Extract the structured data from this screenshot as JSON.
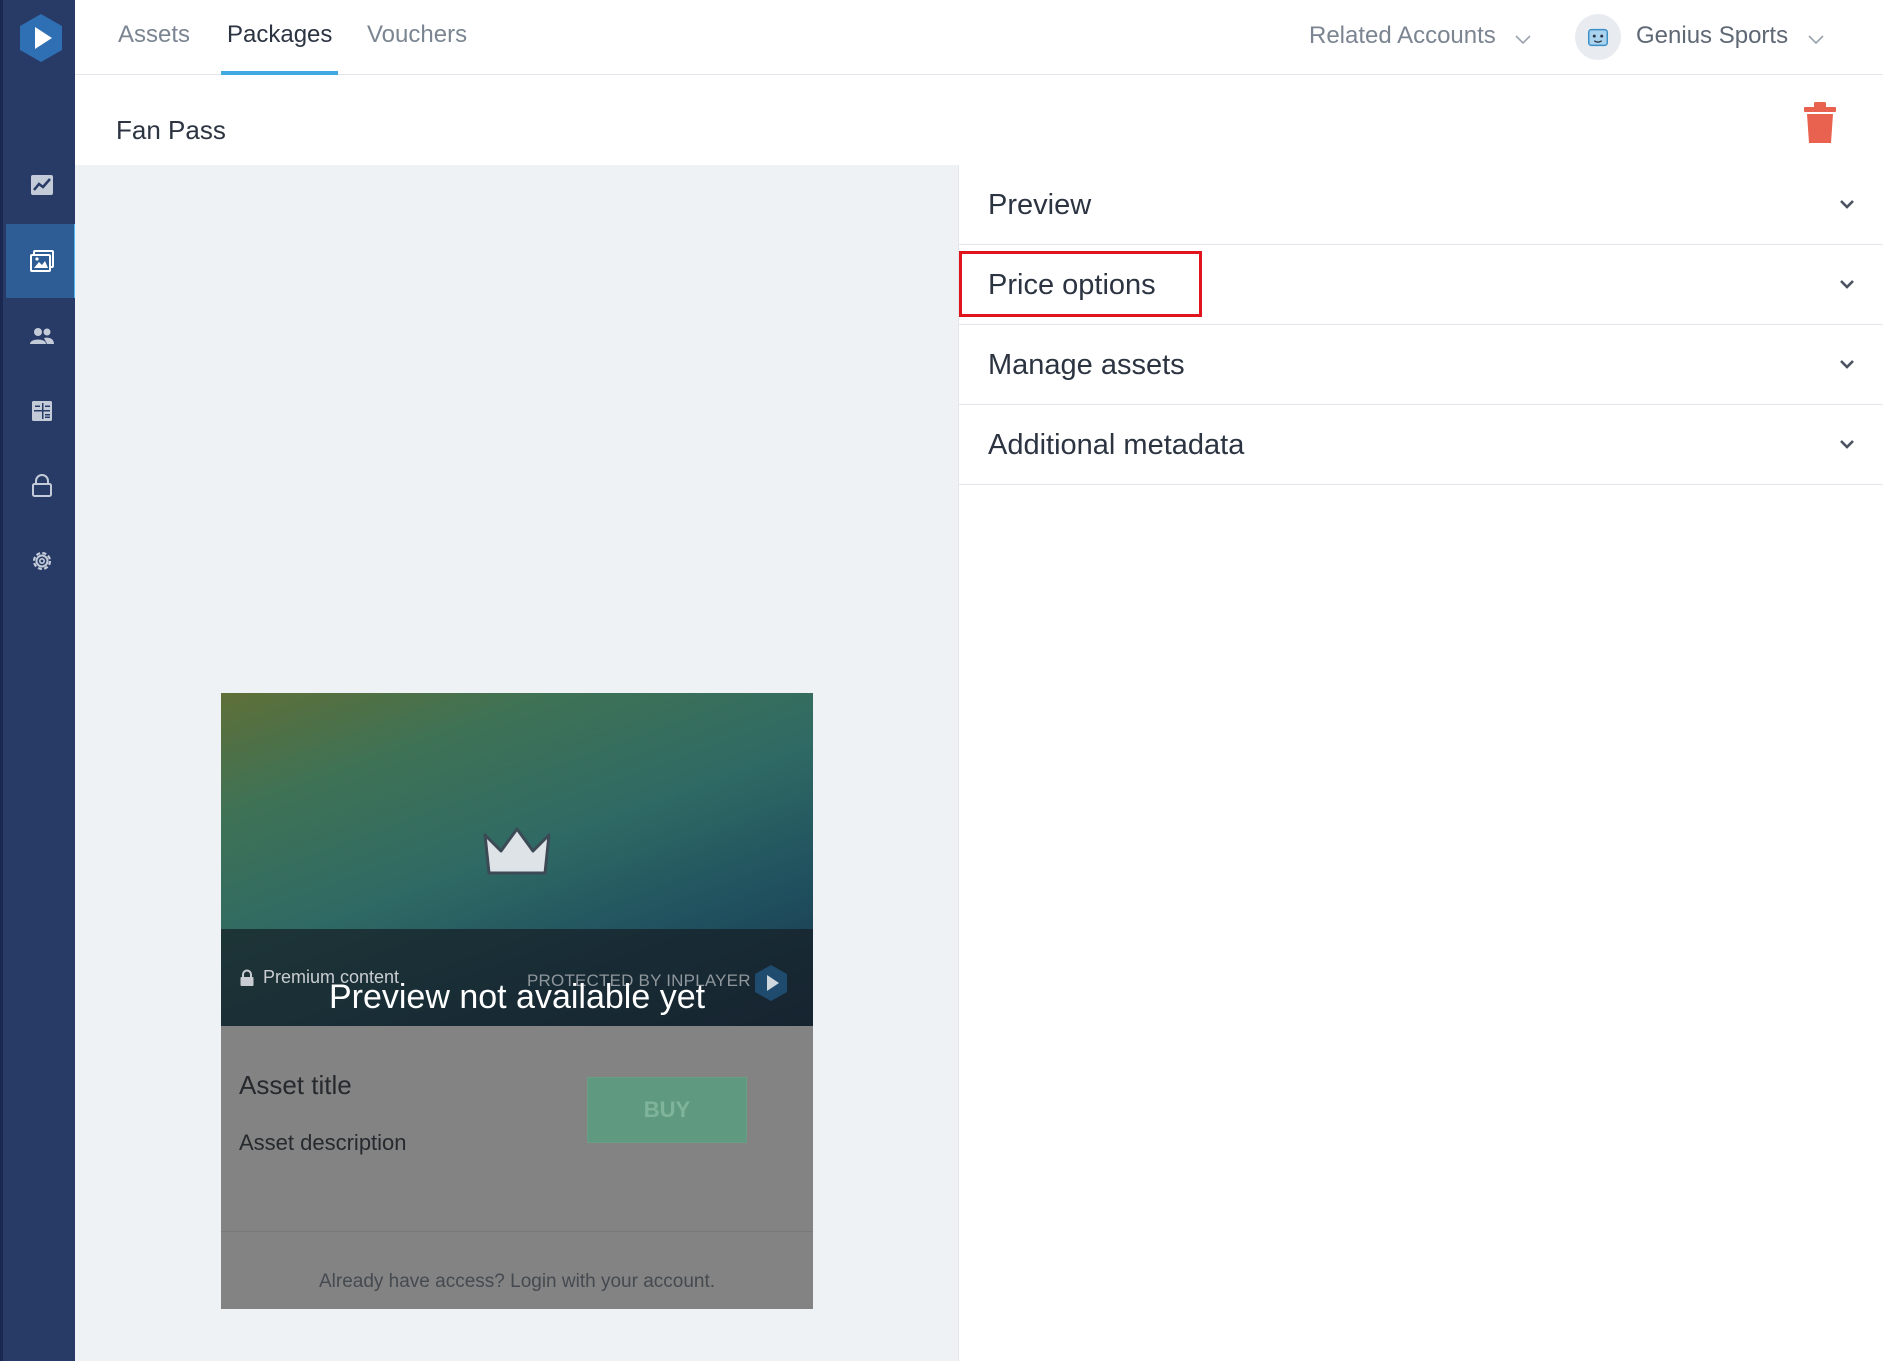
{
  "topbar": {
    "tabs": [
      {
        "label": "Assets"
      },
      {
        "label": "Packages"
      },
      {
        "label": "Vouchers"
      }
    ],
    "related_accounts_label": "Related Accounts",
    "account_name": "Genius Sports"
  },
  "page": {
    "title": "Fan Pass"
  },
  "sidebar": {
    "items": [
      {
        "icon": "analytics-icon"
      },
      {
        "icon": "media-assets-icon",
        "active": true
      },
      {
        "icon": "users-icon"
      },
      {
        "icon": "calculator-icon"
      },
      {
        "icon": "lock-icon"
      },
      {
        "icon": "settings-icon"
      }
    ]
  },
  "preview_card": {
    "premium_label": "Premium content",
    "protected_label": "PROTECTED BY INPLAYER",
    "not_available_text": "Preview not available yet",
    "asset_title": "Asset title",
    "asset_description": "Asset description",
    "buy_label": "BUY",
    "login_text": "Already have access? Login with your account."
  },
  "accordion": {
    "sections": [
      {
        "label": "Preview"
      },
      {
        "label": "Price options"
      },
      {
        "label": "Manage assets"
      },
      {
        "label": "Additional metadata"
      }
    ]
  },
  "colors": {
    "sidebar_bg": "#283a66",
    "active_accent": "#3fa9e0",
    "trash": "#e8624f",
    "highlight": "#e0141c"
  }
}
